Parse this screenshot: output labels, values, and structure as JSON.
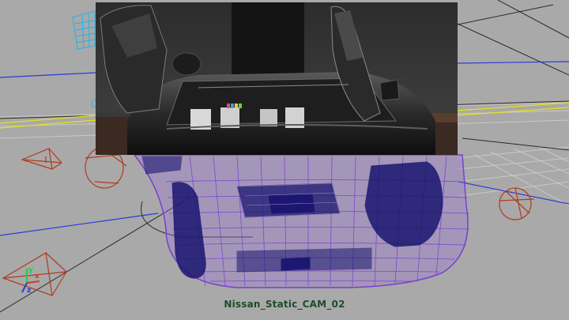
{
  "viewport": {
    "camera_name": "Nissan_Static_CAM_02",
    "axes": {
      "x": "x",
      "y": "y",
      "z": "z"
    }
  },
  "icons": {
    "camera_gizmo": "camera-icon",
    "axis_gizmo": "axis-gizmo-icon"
  },
  "colors": {
    "background": "#a9a9a9",
    "wireframe": "#7a3fd0",
    "wireframe_dark": "#1a1670",
    "grid_line": "#e8e8e8",
    "highlight_line": "#e7e21a",
    "blue_line": "#2d3bd6",
    "camera_gizmo": "#b23a1c",
    "selected_object": "#27b0e8",
    "label": "#1c4d2a"
  }
}
